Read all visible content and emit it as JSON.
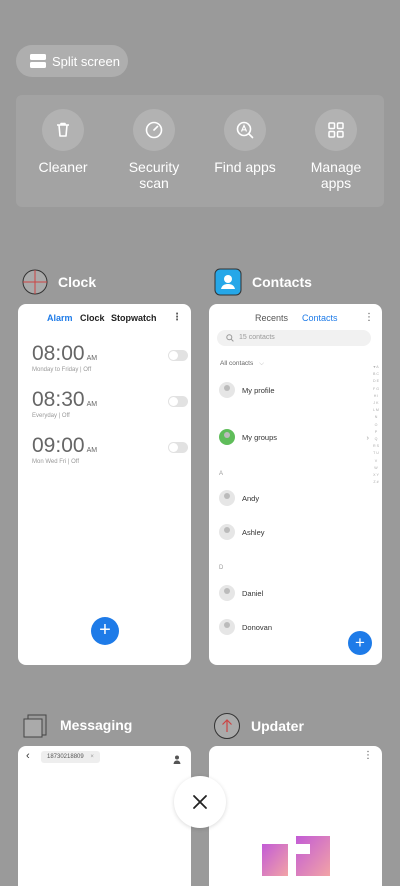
{
  "split_screen": {
    "label": "Split screen"
  },
  "quick_actions": [
    {
      "label": "Cleaner",
      "icon": "trash-icon"
    },
    {
      "label": "Security\nscan",
      "icon": "shield-scan-icon"
    },
    {
      "label": "Find apps",
      "icon": "search-apps-icon"
    },
    {
      "label": "Manage\napps",
      "icon": "grid-icon"
    }
  ],
  "clock": {
    "title": "Clock",
    "tabs": [
      "Alarm",
      "Clock",
      "Stopwatch"
    ],
    "alarms": [
      {
        "time": "08:00",
        "ampm": "AM",
        "sub": "Monday to Friday | Off"
      },
      {
        "time": "08:30",
        "ampm": "AM",
        "sub": "Everyday | Off"
      },
      {
        "time": "09:00",
        "ampm": "AM",
        "sub": "Mon Wed Fri | Off"
      }
    ],
    "add": "+"
  },
  "contacts": {
    "title": "Contacts",
    "tabs": [
      "Recents",
      "Contacts"
    ],
    "search_placeholder": "15 contacts",
    "filter": "All contacts",
    "my_profile": "My profile",
    "my_groups": "My groups",
    "section_a": "A",
    "section_d": "D",
    "people": [
      "Andy",
      "Ashley",
      "Daniel",
      "Donovan"
    ],
    "alphabet": "♥ A B C D E F G H I J K L M N O P Q R S T U V W X Y Z #",
    "add": "+"
  },
  "messaging": {
    "title": "Messaging",
    "recipient": "18730218809"
  },
  "updater": {
    "title": "Updater"
  },
  "colors": {
    "accent": "#1e7be8",
    "background": "#9a9a9a"
  }
}
